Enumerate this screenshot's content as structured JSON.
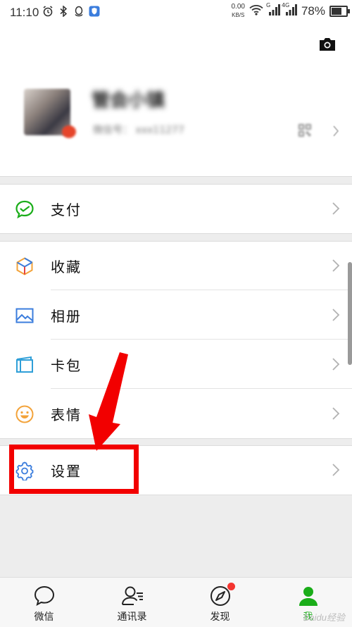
{
  "status_bar": {
    "time": "11:10",
    "net_speed_value": "0.00",
    "net_speed_unit": "KB/S",
    "signal_1_label": "G",
    "signal_2_label": "4G",
    "battery_percent": "78%",
    "battery_level": 0.78,
    "icons": [
      "alarm-icon",
      "bluetooth-icon",
      "qq-icon",
      "shield-icon",
      "wifi-icon",
      "signal-icon",
      "signal-icon",
      "battery-icon"
    ]
  },
  "profile": {
    "nickname": "管会小镇",
    "wxid": "微信号：",
    "wxid_value": "xxx11277"
  },
  "menu": {
    "pay": "支付",
    "favorites": "收藏",
    "album": "相册",
    "cards": "卡包",
    "stickers": "表情",
    "settings": "设置"
  },
  "tabs": [
    {
      "label": "微信"
    },
    {
      "label": "通讯录"
    },
    {
      "label": "发现"
    },
    {
      "label": "我"
    }
  ],
  "watermark": "Baidu经验",
  "colors": {
    "accent_green": "#1aad19",
    "annotation_red": "#f20000",
    "badge_red": "#f43530"
  }
}
